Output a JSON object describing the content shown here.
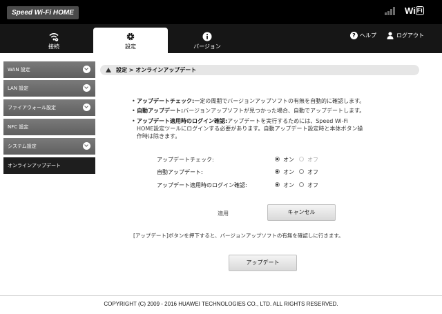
{
  "header": {
    "brand": "Speed Wi-Fi HOME",
    "wifi_logo_a": "Wi",
    "wifi_logo_b": "Fi"
  },
  "nav": {
    "tabs": [
      {
        "label": "接続",
        "icon": "wifi-icon"
      },
      {
        "label": "設定",
        "icon": "gear-icon"
      },
      {
        "label": "バージョン",
        "icon": "info-icon"
      }
    ],
    "help_label": "ヘルプ",
    "logout_label": "ログアウト"
  },
  "sidebar": {
    "items": [
      {
        "label": "WAN 設定",
        "expandable": true
      },
      {
        "label": "LAN 設定",
        "expandable": true
      },
      {
        "label": "ファイアウォール設定",
        "expandable": true
      },
      {
        "label": "NFC 設定",
        "expandable": false
      },
      {
        "label": "システム設定",
        "expandable": true
      },
      {
        "label": "オンラインアップデート",
        "expandable": false,
        "active": true
      }
    ]
  },
  "breadcrumb": "設定 > オンラインアップデート",
  "info": {
    "b1_title": "アップデートチェック:",
    "b1_text": "一定の周期でバージョンアップソフトの有無を自動的に確認します。",
    "b2_title": "自動アップデート:",
    "b2_text": "バージョンアップソフトが見つかった場合、自動でアップデートします。",
    "b3_title": "アップデート適用時のログイン確認:",
    "b3_line1": "アップデートを実行するためには、Speed Wi-Fi",
    "b3_line2": "HOME設定ツールにログインする必要があります。自動アップデート設定時と本体ボタン操",
    "b3_line3": "作時は除きます。"
  },
  "settings": [
    {
      "label": "アップデートチェック:",
      "on": "オン",
      "off": "オフ",
      "value": "on",
      "off_disabled": true
    },
    {
      "label": "自動アップデート:",
      "on": "オン",
      "off": "オフ",
      "value": "on",
      "off_disabled": false
    },
    {
      "label": "アップデート適用時のログイン確認:",
      "on": "オン",
      "off": "オフ",
      "value": "on",
      "off_disabled": false
    }
  ],
  "actions": {
    "apply_label": "適用",
    "cancel_label": "キャンセル",
    "note": "[アップデート]ボタンを押下すると、バージョンアップソフトの有無を確認しに行きます。",
    "update_label": "アップデート"
  },
  "footer": "COPYRIGHT (C) 2009 - 2016 HUAWEI TECHNOLOGIES CO., LTD. ALL RIGHTS RESERVED."
}
